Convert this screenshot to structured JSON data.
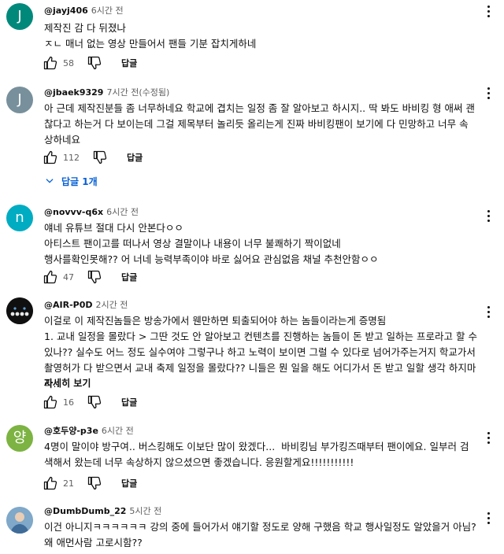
{
  "actions": {
    "reply_label": "답글"
  },
  "comments": [
    {
      "author": "@jayj406",
      "time": "6시간 전",
      "avatar_letter": "J",
      "avatar_color": "#00897b",
      "text": "제작진 감 다 뒤졌나\nㅈㄴ 매너 없는 영상 만들어서 팬들 기분 잡치게하네",
      "likes": "58"
    },
    {
      "author": "@jbaek9329",
      "time": "7시간 전(수정됨)",
      "avatar_letter": "J",
      "avatar_color": "#78909c",
      "text": "아 근데 제작진분들 좀 너무하네요 학교에 겹치는 일정 좀 잘 알아보고 하시지.. 딱 봐도 바비킹 형 애써 괜찮다고 하는거 다 보이는데 그걸 제목부터 놀리듯 올리는게 진짜 바비킹팬이 보기에 다 민망하고 너무 속상하네요",
      "likes": "112",
      "replies_label": "답글 1개"
    },
    {
      "author": "@novvv-q6x",
      "time": "6시간 전",
      "avatar_letter": "n",
      "avatar_color": "#00acc1",
      "text": "얘네 유튜브 절대 다시 안본다ㅇㅇ\n아티스트 팬이고를 떠나서 영상 결말이나 내용이 너무 불쾌하기 짝이없네\n행사를확인못해?? 어 너네 능력부족이야 바로 싫어요 관심없음 채널 추천안함ㅇㅇ",
      "likes": "47"
    },
    {
      "author": "@AIR-P0D",
      "time": "2시간 전",
      "avatar_letter": "",
      "avatar_color": "#101010",
      "text": "이걸로 이 제작진놈들은 방송가에서 웬만하면 퇴출되어야 하는 놈들이라는게 증명됨\n1. 교내 일정을 몰랐다 > 그딴 것도 안 알아보고 컨텐츠를 진행하는 놈들이 돈 받고 일하는 프로라고 할 수 있나?? 실수도 어느 정도 실수여야 그렇구나 하고 노력이 보이면 그럴 수 있다로 넘어가주는거지 학교가서 촬영허가 다 받으면서 교내 축제 일정을 몰랐다?? 니들은 뭔 일을 해도 어디가서 돈 받고 일할 생각 하지마라..",
      "read_more": "자세히 보기",
      "likes": "16"
    },
    {
      "author": "@호두양-p3e",
      "time": "6시간 전",
      "avatar_letter": "양",
      "avatar_color": "#7cb342",
      "text": "4명이 말이야 방구여.. 버스킹해도 이보단 많이 왔겠다...  바비킹님 부가킹즈때부터 팬이에요. 일부러 검색해서 왔는데 너무 속상하지 않으셨으면 좋겠습니다. 응원할게요!!!!!!!!!!!",
      "likes": "21"
    },
    {
      "author": "@DumbDumb_22",
      "time": "5시간 전",
      "avatar_letter": "",
      "avatar_color": "#7fa8c9",
      "text": "이건 아니지ㅋㅋㅋㅋㅋㅋ 강의 중에 들어가서 얘기할 정도로 양해 구했음 학교 행사일정도 알았을거 아님?\n왜 애먼사람 고로시함??"
    }
  ]
}
